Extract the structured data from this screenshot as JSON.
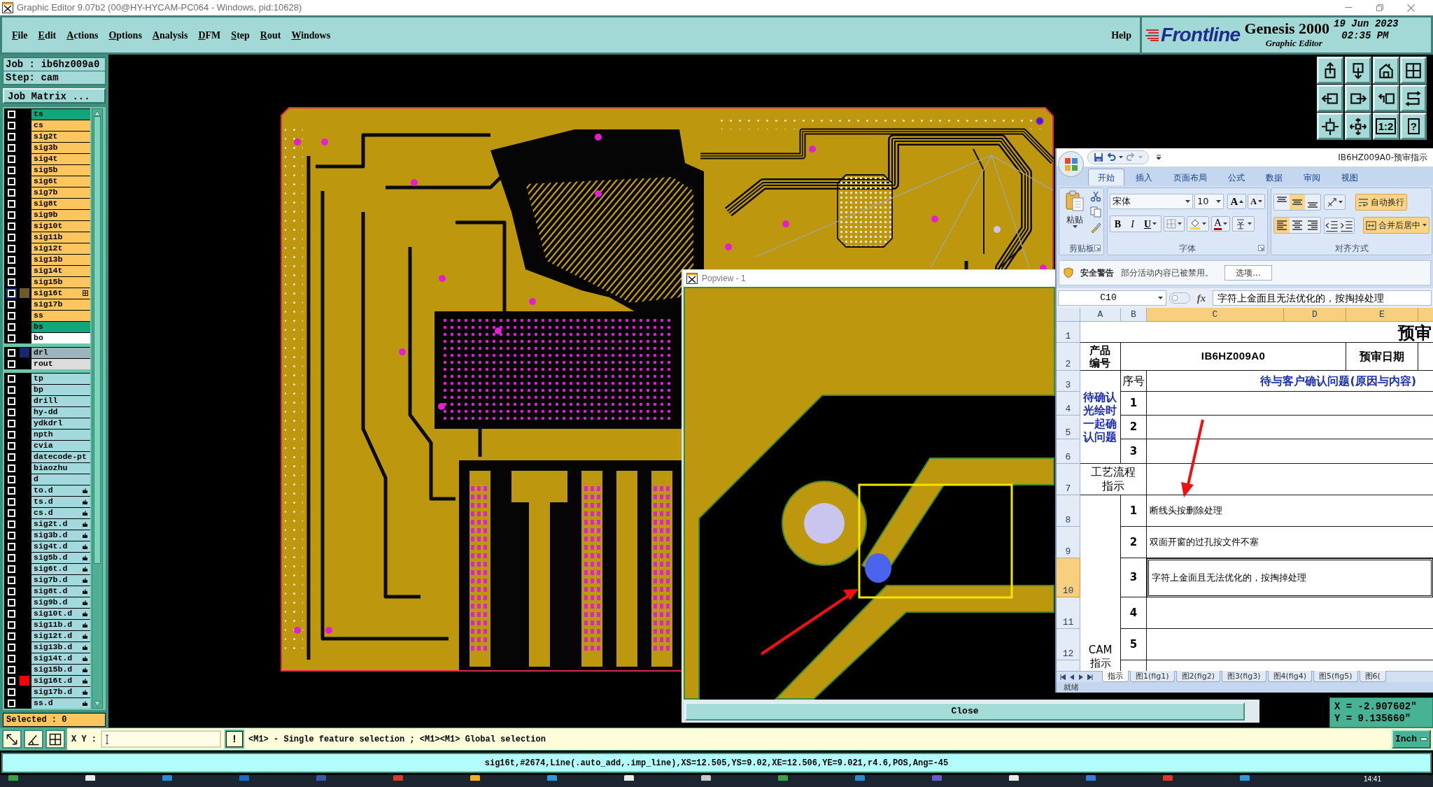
{
  "window": {
    "title": "Graphic Editor 9.07b2 (00@HY-HYCAM-PC064 - Windows, pid:10628)"
  },
  "menu": [
    "File",
    "Edit",
    "Actions",
    "Options",
    "Analysis",
    "DFM",
    "Step",
    "Rout",
    "Windows"
  ],
  "help": "Help",
  "brand": {
    "logo": "Frontline",
    "product": "Genesis 2000",
    "module": "Graphic Editor",
    "date": "19 Jun 2023",
    "time": "02:35 PM"
  },
  "job": {
    "job": "Job : ib6hz009a0",
    "step": "Step: cam",
    "matrix_button": "Job Matrix ..."
  },
  "layer_groups": [
    {
      "layers": [
        {
          "name": "ts",
          "kind": "mask",
          "selected": false
        },
        {
          "name": "cs",
          "kind": "signal",
          "selected": false
        },
        {
          "name": "sig2t",
          "kind": "signal",
          "selected": false
        },
        {
          "name": "sig3b",
          "kind": "signal",
          "selected": false
        },
        {
          "name": "sig4t",
          "kind": "signal",
          "selected": false
        },
        {
          "name": "sig5b",
          "kind": "signal",
          "selected": false
        },
        {
          "name": "sig6t",
          "kind": "signal",
          "selected": false
        },
        {
          "name": "sig7b",
          "kind": "signal",
          "selected": false
        },
        {
          "name": "sig8t",
          "kind": "signal",
          "selected": false
        },
        {
          "name": "sig9b",
          "kind": "signal",
          "selected": false
        },
        {
          "name": "sig10t",
          "kind": "signal",
          "selected": false
        },
        {
          "name": "sig11b",
          "kind": "signal",
          "selected": false
        },
        {
          "name": "sig12t",
          "kind": "signal",
          "selected": false
        },
        {
          "name": "sig13b",
          "kind": "signal",
          "selected": false
        },
        {
          "name": "sig14t",
          "kind": "signal",
          "selected": false
        },
        {
          "name": "sig15b",
          "kind": "signal",
          "selected": false
        },
        {
          "name": "sig16t",
          "kind": "signal",
          "selected": true,
          "color": "#6e5a2a"
        },
        {
          "name": "sig17b",
          "kind": "signal",
          "selected": false
        },
        {
          "name": "ss",
          "kind": "signal",
          "selected": false
        },
        {
          "name": "bs",
          "kind": "mask",
          "selected": false
        },
        {
          "name": "bo",
          "kind": "silk",
          "selected": false
        }
      ]
    },
    {
      "layers": [
        {
          "name": "drl",
          "kind": "drill",
          "selected": false,
          "color": "#1a2768"
        },
        {
          "name": "rout",
          "kind": "rout",
          "selected": false
        }
      ]
    },
    {
      "layers": [
        {
          "name": "tp",
          "kind": "doc",
          "selected": false
        },
        {
          "name": "bp",
          "kind": "doc",
          "selected": false
        },
        {
          "name": "drill",
          "kind": "doc",
          "selected": false
        },
        {
          "name": "hy-dd",
          "kind": "doc",
          "selected": false
        },
        {
          "name": "ydkdrl",
          "kind": "doc",
          "selected": false
        },
        {
          "name": "npth",
          "kind": "doc",
          "selected": false
        },
        {
          "name": "cvia",
          "kind": "doc",
          "selected": false
        },
        {
          "name": "datecode-pt",
          "kind": "doc",
          "selected": false
        },
        {
          "name": "biaozhu",
          "kind": "doc",
          "selected": false
        },
        {
          "name": "d",
          "kind": "doc",
          "selected": false
        },
        {
          "name": "to.d",
          "kind": "doc_ref",
          "selected": false
        },
        {
          "name": "ts.d",
          "kind": "doc_ref",
          "selected": false
        },
        {
          "name": "cs.d",
          "kind": "doc_ref",
          "selected": false
        },
        {
          "name": "sig2t.d",
          "kind": "doc_ref",
          "selected": false
        },
        {
          "name": "sig3b.d",
          "kind": "doc_ref",
          "selected": false
        },
        {
          "name": "sig4t.d",
          "kind": "doc_ref",
          "selected": false
        },
        {
          "name": "sig5b.d",
          "kind": "doc_ref",
          "selected": false
        },
        {
          "name": "sig6t.d",
          "kind": "doc_ref",
          "selected": false
        },
        {
          "name": "sig7b.d",
          "kind": "doc_ref",
          "selected": false
        },
        {
          "name": "sig8t.d",
          "kind": "doc_ref",
          "selected": false
        },
        {
          "name": "sig9b.d",
          "kind": "doc_ref",
          "selected": false
        },
        {
          "name": "sig10t.d",
          "kind": "doc_ref",
          "selected": false
        },
        {
          "name": "sig11b.d",
          "kind": "doc_ref",
          "selected": false
        },
        {
          "name": "sig12t.d",
          "kind": "doc_ref",
          "selected": false
        },
        {
          "name": "sig13b.d",
          "kind": "doc_ref",
          "selected": false
        },
        {
          "name": "sig14t.d",
          "kind": "doc_ref",
          "selected": false
        },
        {
          "name": "sig15b.d",
          "kind": "doc_ref",
          "selected": false
        },
        {
          "name": "sig16t.d",
          "kind": "doc_ref",
          "selected": false,
          "color": "#ff0000"
        },
        {
          "name": "sig17b.d",
          "kind": "doc_ref",
          "selected": false
        },
        {
          "name": "ss.d",
          "kind": "doc_ref",
          "selected": false
        }
      ]
    }
  ],
  "selected_count": "Selected : 0",
  "view_tools": [
    {
      "kind": "up"
    },
    {
      "kind": "down"
    },
    {
      "kind": "home"
    },
    {
      "kind": "grid"
    },
    {
      "kind": "left"
    },
    {
      "kind": "right"
    },
    {
      "kind": "back"
    },
    {
      "kind": "redraw"
    },
    {
      "kind": "fit"
    },
    {
      "kind": "pan"
    },
    {
      "kind": "ratio",
      "label": "1:2"
    },
    {
      "kind": "help",
      "label": "?"
    }
  ],
  "coordinates": {
    "x": "X = -2.907602\"",
    "y": "Y = 9.135660\""
  },
  "popview": {
    "title": "Popview - 1",
    "close": "Close"
  },
  "excel": {
    "title": "IB6HZ009A0-预审指示",
    "tabs": [
      {
        "label": "开始",
        "selected": true
      },
      {
        "label": "插入",
        "selected": false
      },
      {
        "label": "页面布局",
        "selected": false
      },
      {
        "label": "公式",
        "selected": false
      },
      {
        "label": "数据",
        "selected": false
      },
      {
        "label": "审阅",
        "selected": false
      },
      {
        "label": "视图",
        "selected": false
      }
    ],
    "clipboard": {
      "paste": "粘贴",
      "group": "剪贴板"
    },
    "font": {
      "name": "宋体",
      "size": "10",
      "grow": "A",
      "shrink": "A",
      "bold": "B",
      "italic": "I",
      "underline": "U",
      "foreground": "A",
      "group": "字体"
    },
    "alignment": {
      "vertical": [
        {
          "kind": "top",
          "selected": false
        },
        {
          "kind": "middle",
          "selected": true
        },
        {
          "kind": "bottom",
          "selected": false
        }
      ],
      "horizontal": [
        {
          "kind": "left",
          "selected": true
        },
        {
          "kind": "center",
          "selected": false
        },
        {
          "kind": "right",
          "selected": false
        }
      ],
      "wrap": {
        "label": "自动换行",
        "on": true
      },
      "merge": {
        "label": "合并后居中",
        "on": true
      },
      "group": "对齐方式"
    },
    "security": {
      "title": "安全警告",
      "message": "部分活动内容已被禁用。",
      "button": "选项..."
    },
    "name_box": "C10",
    "fx": "fx",
    "formula": "字符上金面且无法优化的，按掏掉处理",
    "columns": [
      {
        "label": "A",
        "selected": false
      },
      {
        "label": "B",
        "selected": false
      },
      {
        "label": "C",
        "selected": true
      },
      {
        "label": "D",
        "selected": true
      },
      {
        "label": "E",
        "selected": true
      }
    ],
    "rows": [
      {
        "label": "1",
        "selected": false
      },
      {
        "label": "2",
        "selected": false
      },
      {
        "label": "3",
        "selected": false
      },
      {
        "label": "4",
        "selected": false
      },
      {
        "label": "5",
        "selected": false
      },
      {
        "label": "6",
        "selected": false
      },
      {
        "label": "7",
        "selected": false
      },
      {
        "label": "8",
        "selected": false
      },
      {
        "label": "9",
        "selected": false
      },
      {
        "label": "10",
        "selected": true
      },
      {
        "label": "11",
        "selected": false
      },
      {
        "label": "12",
        "selected": false
      }
    ],
    "sheet_title": "预审",
    "product_label": "产品编号",
    "product_code": "IB6HZ009A0",
    "date_label": "预审日期",
    "no_header": "序号",
    "question_header": "待与客户确认问题(原因与内容)",
    "confirm_label": "待确认光绘时一起确认问题",
    "confirm_numbers": [
      "1",
      "2",
      "3"
    ],
    "process_label": "工艺流程指示",
    "cam_label": "CAM指示",
    "cam_items": [
      {
        "no": "1",
        "text": "断线头按删除处理",
        "selected": false
      },
      {
        "no": "2",
        "text": "双面开窗的过孔按文件不塞",
        "selected": false
      },
      {
        "no": "3",
        "text": "字符上金面且无法优化的，按掏掉处理",
        "selected": true
      },
      {
        "no": "4",
        "selected": false
      },
      {
        "no": "5",
        "selected": false
      }
    ],
    "sheets": [
      {
        "label": "指示",
        "selected": true
      },
      {
        "label": "图1(fig1)",
        "selected": false
      },
      {
        "label": "图2(fig2)",
        "selected": false
      },
      {
        "label": "图3(fig3)",
        "selected": false
      },
      {
        "label": "图4(fig4)",
        "selected": false
      },
      {
        "label": "图5(fig5)",
        "selected": false
      },
      {
        "label": "图6(",
        "selected": false
      }
    ],
    "status": "就绪"
  },
  "command": {
    "tools": [
      {
        "kind": "zoom"
      },
      {
        "kind": "measure"
      },
      {
        "kind": "snap"
      }
    ],
    "xy_label": "X Y :",
    "exec": "!",
    "hint": "<M1> - Single feature selection ; <M1><M1> Global selection",
    "units": "Inch"
  },
  "status": "sig16t,#2674,Line(.auto_add,.imp_line),XS=12.505,YS=9.02,XE=12.506,YE=9.021,r4.6,POS,Ang=-45",
  "taskbar": {
    "time": "14:41"
  }
}
